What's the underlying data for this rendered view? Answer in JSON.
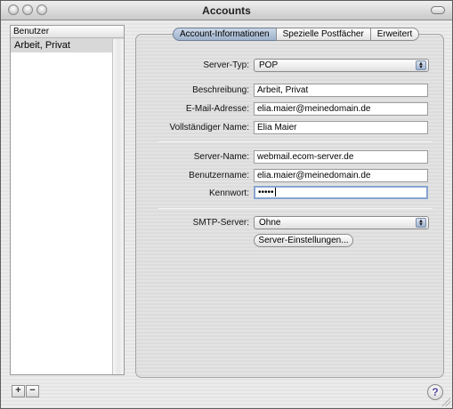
{
  "window": {
    "title": "Accounts"
  },
  "sidebar": {
    "header": "Benutzer",
    "accounts": [
      "Arbeit, Privat"
    ],
    "add_label": "+",
    "remove_label": "−"
  },
  "tabs": [
    {
      "label": "Account-Informationen",
      "active": true
    },
    {
      "label": "Spezielle Postfächer",
      "active": false
    },
    {
      "label": "Erweitert",
      "active": false
    }
  ],
  "form": {
    "server_type": {
      "label": "Server-Typ:",
      "value": "POP"
    },
    "description": {
      "label": "Beschreibung:",
      "value": "Arbeit, Privat"
    },
    "email": {
      "label": "E-Mail-Adresse:",
      "value": "elia.maier@meinedomain.de"
    },
    "full_name": {
      "label": "Vollständiger Name:",
      "value": "Elia Maier"
    },
    "server_name": {
      "label": "Server-Name:",
      "value": "webmail.ecom-server.de"
    },
    "username": {
      "label": "Benutzername:",
      "value": "elia.maier@meinedomain.de"
    },
    "password": {
      "label": "Kennwort:",
      "value": "•••••"
    },
    "smtp": {
      "label": "SMTP-Server:",
      "value": "Ohne",
      "settings_button": "Server-Einstellungen..."
    }
  },
  "help_label": "?",
  "colors": {
    "selected_tab": "#9eb2cc",
    "focus_ring": "#87a4cf",
    "popup_arrow": "#9db2d0"
  }
}
